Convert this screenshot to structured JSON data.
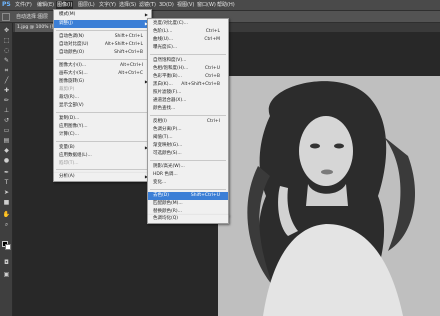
{
  "app": {
    "logo": "PS"
  },
  "menubar": {
    "items": [
      "文件(F)",
      "编辑(E)",
      "图像(I)",
      "图层(L)",
      "文字(Y)",
      "选择(S)",
      "滤镜(T)",
      "3D(D)",
      "视图(V)",
      "窗口(W)",
      "帮助(H)"
    ]
  },
  "options": {
    "label1": "自动选择：",
    "label2": "图层"
  },
  "document_tab": {
    "title": "1.jpg @ 100% (图层 0, RGB/8)"
  },
  "image_menu": {
    "items": [
      {
        "label": "模式(M)",
        "shortcut": "",
        "submenu": true
      },
      {
        "label": "调整(J)",
        "shortcut": "",
        "submenu": true,
        "highlighted": true
      },
      {
        "label": "自动色调(N)",
        "shortcut": "Shift+Ctrl+L"
      },
      {
        "label": "自动对比度(U)",
        "shortcut": "Alt+Shift+Ctrl+L"
      },
      {
        "label": "自动颜色(O)",
        "shortcut": "Shift+Ctrl+B"
      },
      {
        "label": "图像大小(I)...",
        "shortcut": "Alt+Ctrl+I"
      },
      {
        "label": "画布大小(S)...",
        "shortcut": "Alt+Ctrl+C"
      },
      {
        "label": "图像旋转(G)",
        "shortcut": "",
        "submenu": true
      },
      {
        "label": "裁剪(P)",
        "shortcut": "",
        "disabled": true
      },
      {
        "label": "裁切(R)...",
        "shortcut": ""
      },
      {
        "label": "显示全部(V)",
        "shortcut": ""
      },
      {
        "label": "复制(D)...",
        "shortcut": ""
      },
      {
        "label": "应用图像(Y)...",
        "shortcut": ""
      },
      {
        "label": "计算(C)...",
        "shortcut": ""
      },
      {
        "label": "变量(B)",
        "shortcut": "",
        "submenu": true
      },
      {
        "label": "应用数据组(L)...",
        "shortcut": ""
      },
      {
        "label": "陷印(T)...",
        "shortcut": "",
        "disabled": true
      },
      {
        "label": "分析(A)",
        "shortcut": "",
        "submenu": true
      }
    ]
  },
  "adjust_menu": {
    "items": [
      {
        "label": "亮度/对比度(C)...",
        "shortcut": ""
      },
      {
        "label": "色阶(L)...",
        "shortcut": "Ctrl+L"
      },
      {
        "label": "曲线(U)...",
        "shortcut": "Ctrl+M"
      },
      {
        "label": "曝光度(E)...",
        "shortcut": ""
      },
      {
        "label": "自然饱和度(V)...",
        "shortcut": ""
      },
      {
        "label": "色相/饱和度(H)...",
        "shortcut": "Ctrl+U"
      },
      {
        "label": "色彩平衡(B)...",
        "shortcut": "Ctrl+B"
      },
      {
        "label": "黑白(K)...",
        "shortcut": "Alt+Shift+Ctrl+B"
      },
      {
        "label": "照片滤镜(F)...",
        "shortcut": ""
      },
      {
        "label": "通道混合器(X)...",
        "shortcut": ""
      },
      {
        "label": "颜色查找...",
        "shortcut": ""
      },
      {
        "label": "反相(I)",
        "shortcut": "Ctrl+I"
      },
      {
        "label": "色调分离(P)...",
        "shortcut": ""
      },
      {
        "label": "阈值(T)...",
        "shortcut": ""
      },
      {
        "label": "渐变映射(G)...",
        "shortcut": ""
      },
      {
        "label": "可选颜色(S)...",
        "shortcut": ""
      },
      {
        "label": "阴影/高光(W)...",
        "shortcut": ""
      },
      {
        "label": "HDR 色调...",
        "shortcut": ""
      },
      {
        "label": "变化...",
        "shortcut": ""
      },
      {
        "label": "去色(D)",
        "shortcut": "Shift+Ctrl+U",
        "highlighted": true
      },
      {
        "label": "匹配颜色(M)...",
        "shortcut": ""
      },
      {
        "label": "替换颜色(R)...",
        "shortcut": ""
      },
      {
        "label": "色调均化(Q)",
        "shortcut": ""
      }
    ]
  },
  "colors": {
    "menu_highlight": "#3c7fd6",
    "app_bg": "#262626",
    "logo": "#6fb7ff"
  }
}
